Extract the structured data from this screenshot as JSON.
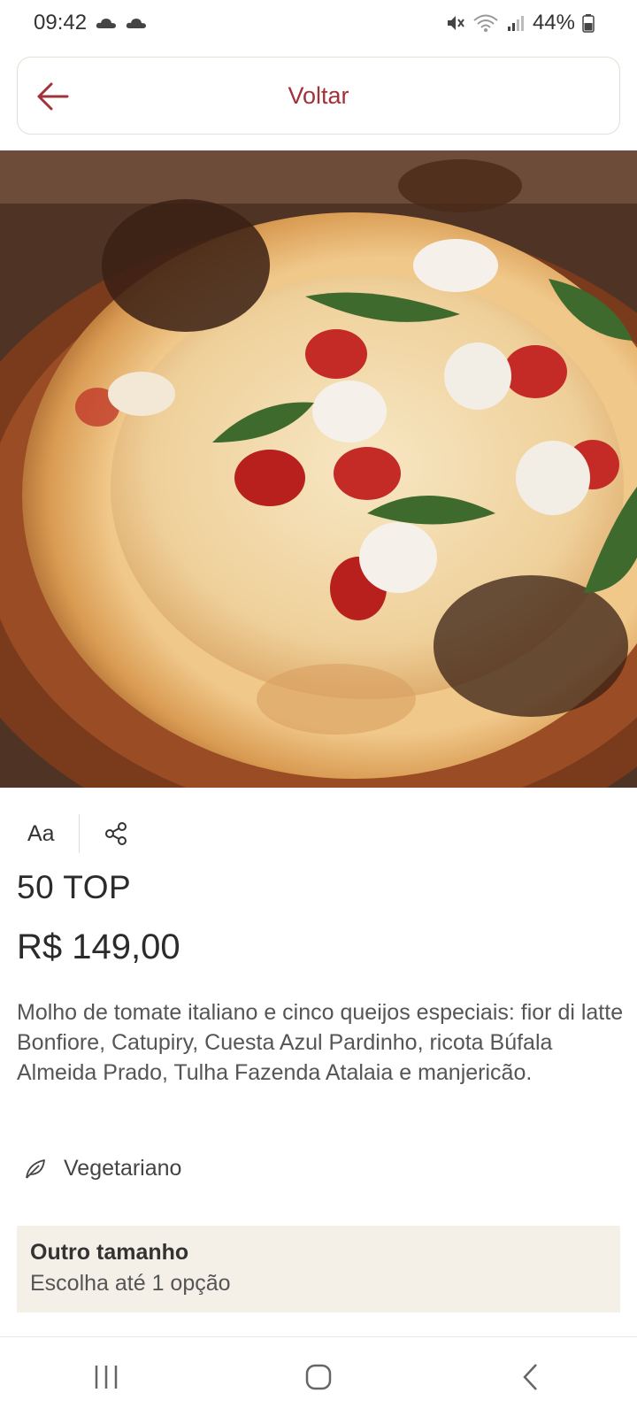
{
  "status": {
    "time": "09:42",
    "battery": "44%",
    "icons": [
      "cloud-icon",
      "cloud-icon",
      "mute-icon",
      "wifi-icon",
      "signal-icon",
      "battery-icon"
    ]
  },
  "header": {
    "back_label": "Voltar",
    "back_icon": "arrow-left-icon"
  },
  "product": {
    "image": "pizza-photo",
    "text_size_label": "Aa",
    "share_icon": "share-icon",
    "name": "50 TOP",
    "price": "R$ 149,00",
    "description": "Molho de tomate italiano e cinco queijos especiais: fior di latte Bonfiore, Catupiry, Cuesta Azul Pardinho, ricota Búfala Almeida Prado, Tulha Fazenda Atalaia e manjericão.",
    "tag": "Vegetariano",
    "tag_icon": "leaf-icon"
  },
  "options": {
    "title": "Outro tamanho",
    "subtitle": "Escolha até 1 opção"
  },
  "nav": {
    "recents_icon": "recents-icon",
    "home_icon": "home-icon",
    "back_icon": "back-icon"
  },
  "colors": {
    "accent": "#a2313a",
    "option_bg": "#f4f0e8"
  }
}
